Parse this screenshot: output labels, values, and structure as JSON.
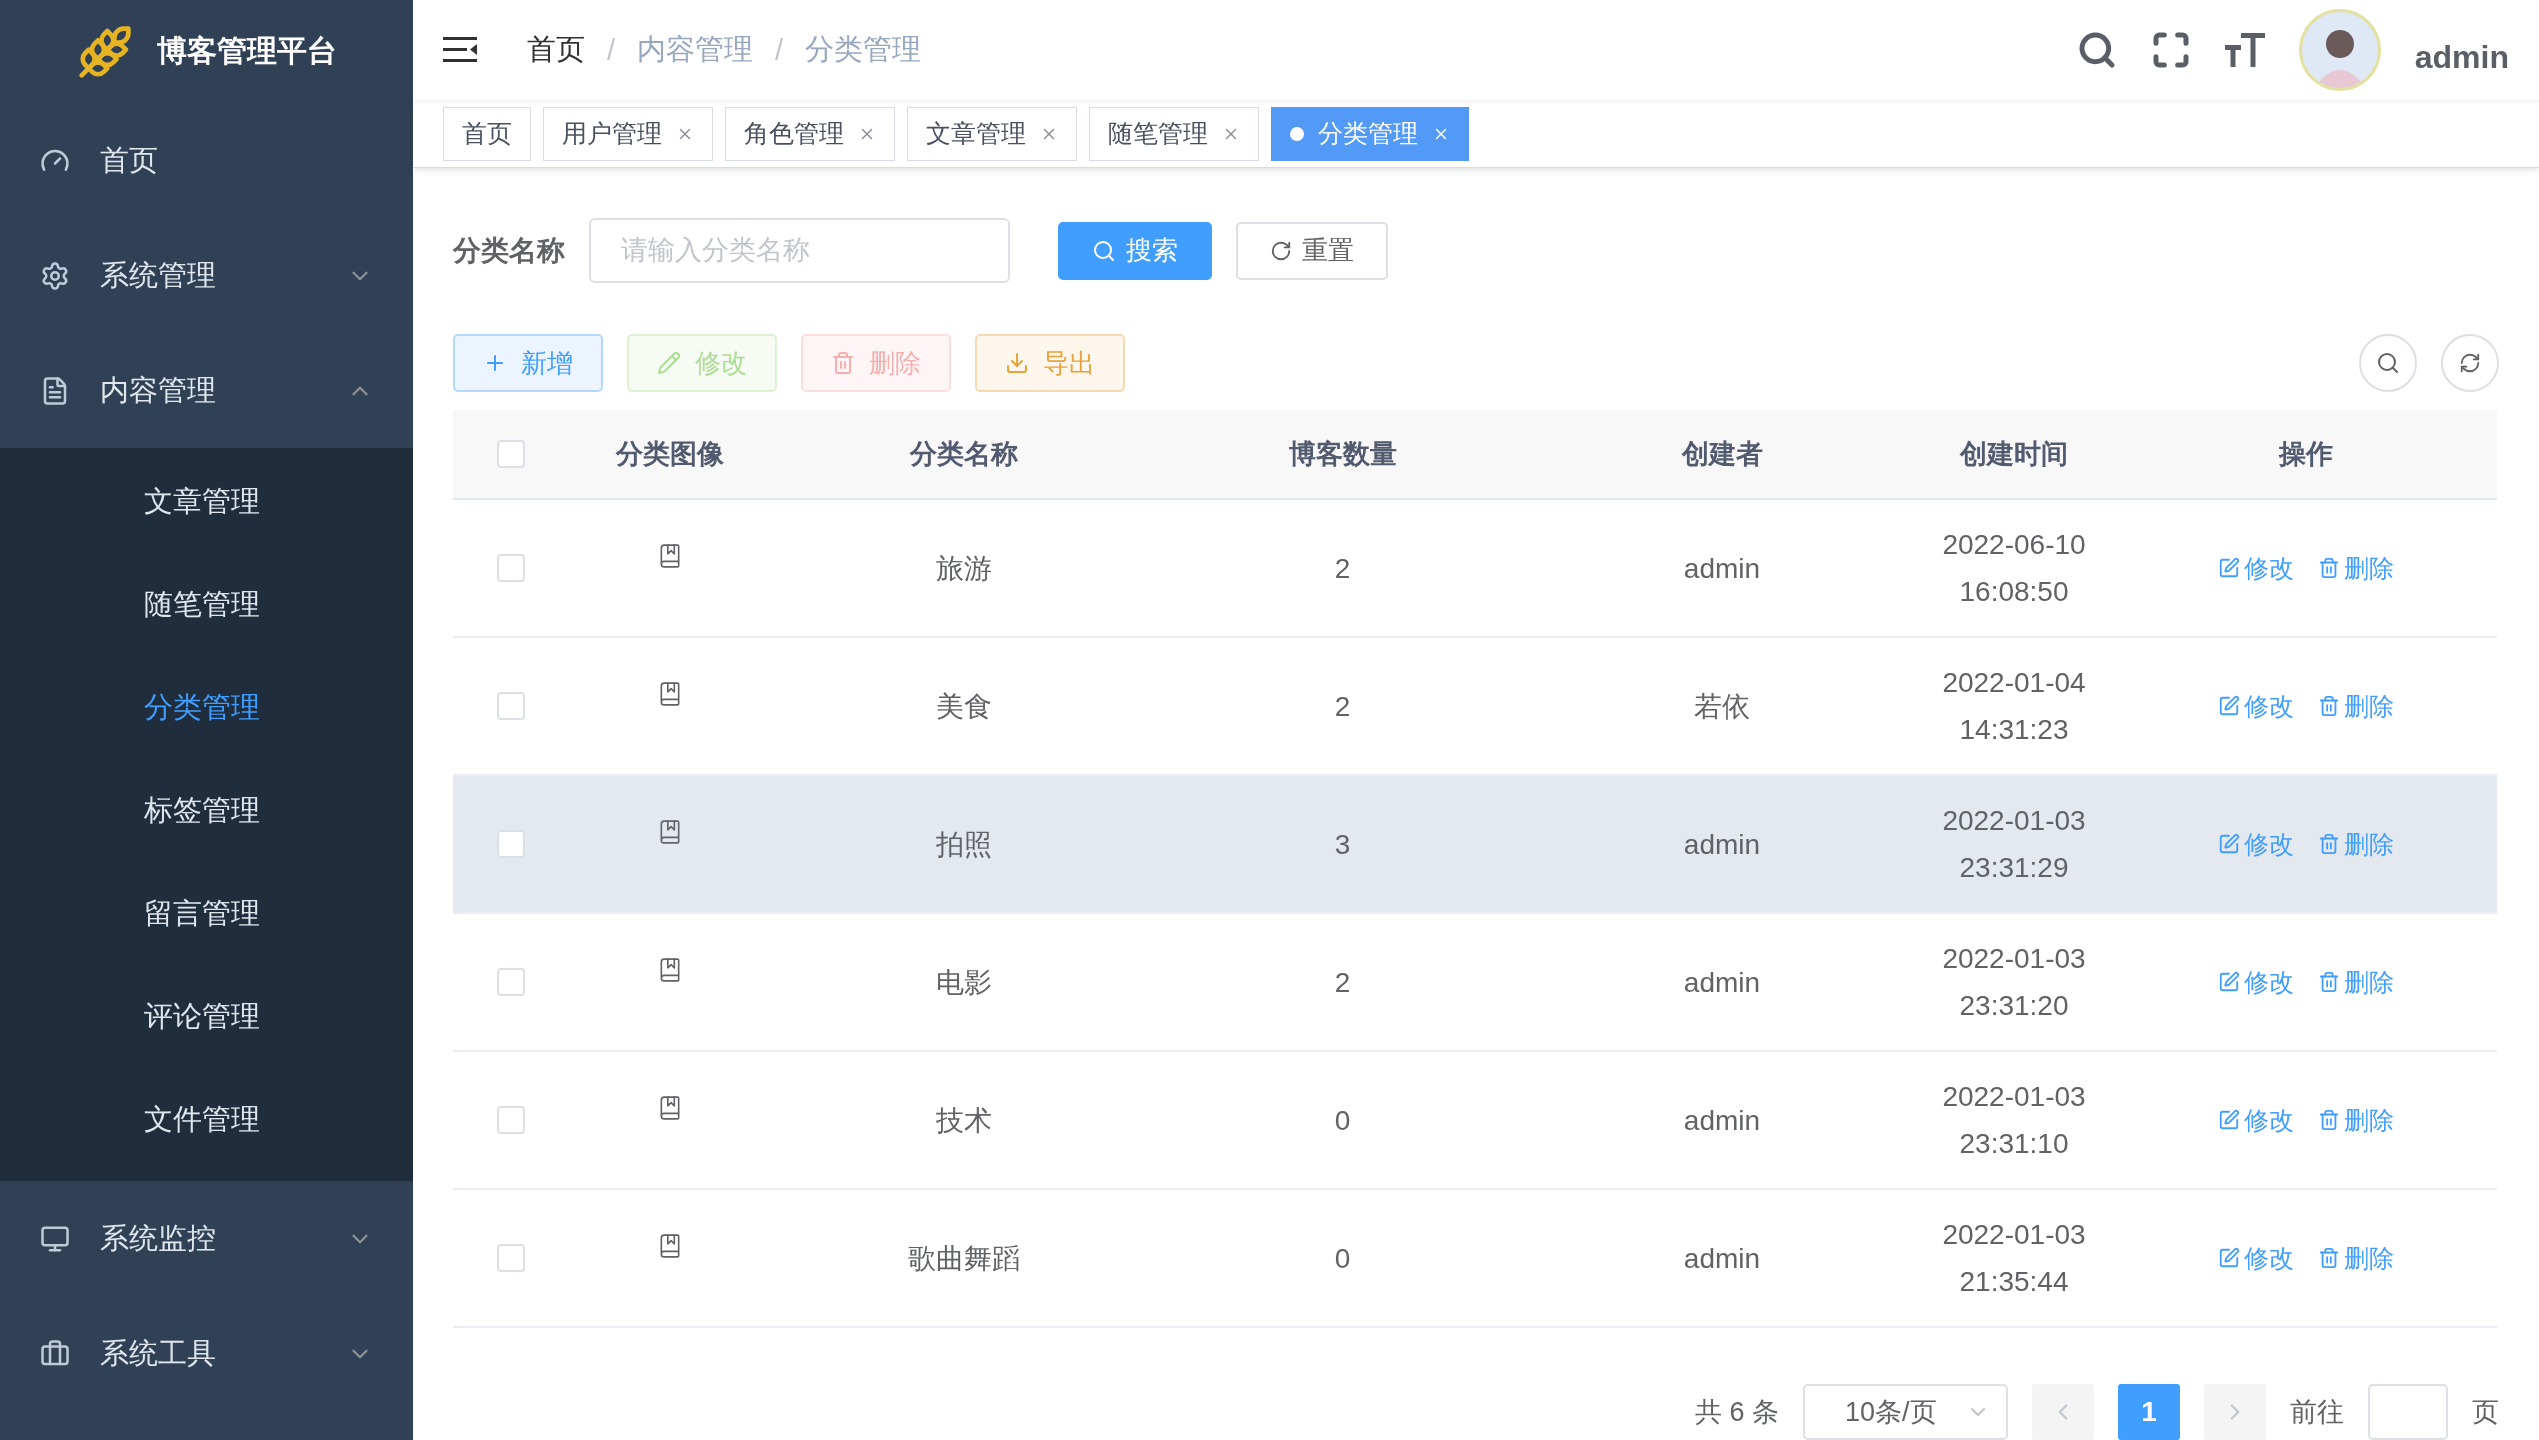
{
  "sidebar": {
    "title": "博客管理平台",
    "menu": [
      {
        "kind": "link",
        "label": "首页"
      },
      {
        "kind": "group",
        "label": "系统管理",
        "expanded": false
      },
      {
        "kind": "group",
        "label": "内容管理",
        "expanded": true,
        "children": [
          {
            "label": "文章管理",
            "selected": false
          },
          {
            "label": "随笔管理",
            "selected": false
          },
          {
            "label": "分类管理",
            "selected": true
          },
          {
            "label": "标签管理",
            "selected": false
          },
          {
            "label": "留言管理",
            "selected": false
          },
          {
            "label": "评论管理",
            "selected": false
          },
          {
            "label": "文件管理",
            "selected": false
          }
        ]
      },
      {
        "kind": "group",
        "label": "系统监控",
        "expanded": false
      },
      {
        "kind": "group",
        "label": "系统工具",
        "expanded": false
      }
    ]
  },
  "header": {
    "breadcrumb": [
      {
        "kind": "link",
        "label": "首页"
      },
      {
        "kind": "separator",
        "label": "/"
      },
      {
        "kind": "current",
        "label": "内容管理"
      },
      {
        "kind": "separator",
        "label": "/"
      },
      {
        "kind": "current",
        "label": "分类管理"
      }
    ],
    "user": {
      "name": "admin"
    }
  },
  "tabs": [
    {
      "label": "首页",
      "selected": false,
      "closable": false
    },
    {
      "label": "用户管理",
      "selected": false,
      "closable": true
    },
    {
      "label": "角色管理",
      "selected": false,
      "closable": true
    },
    {
      "label": "文章管理",
      "selected": false,
      "closable": true
    },
    {
      "label": "随笔管理",
      "selected": false,
      "closable": true
    },
    {
      "label": "分类管理",
      "selected": true,
      "closable": true
    }
  ],
  "search_form": {
    "label": "分类名称",
    "placeholder": "请输入分类名称",
    "buttons": [
      {
        "kind": "primary",
        "label": "搜索"
      },
      {
        "kind": "default",
        "label": "重置"
      }
    ]
  },
  "toolbar": {
    "buttons": [
      {
        "kind": "primary",
        "label": "新增",
        "disabled": false
      },
      {
        "kind": "success",
        "label": "修改",
        "disabled": true
      },
      {
        "kind": "danger",
        "label": "删除",
        "disabled": true
      },
      {
        "kind": "warning",
        "label": "导出",
        "disabled": false
      }
    ]
  },
  "table": {
    "header_checked": false,
    "columns": [
      "分类图像",
      "分类名称",
      "博客数量",
      "创建者",
      "创建时间",
      "操作"
    ],
    "rows": [
      {
        "checked": false,
        "highlighted": false,
        "name": "旅游",
        "count": "2",
        "creator": "admin",
        "created": "2022-06-10 16:08:50",
        "actions": [
          "修改",
          "删除"
        ]
      },
      {
        "checked": false,
        "highlighted": false,
        "name": "美食",
        "count": "2",
        "creator": "若依",
        "created": "2022-01-04 14:31:23",
        "actions": [
          "修改",
          "删除"
        ]
      },
      {
        "checked": false,
        "highlighted": true,
        "name": "拍照",
        "count": "3",
        "creator": "admin",
        "created": "2022-01-03 23:31:29",
        "actions": [
          "修改",
          "删除"
        ]
      },
      {
        "checked": false,
        "highlighted": false,
        "name": "电影",
        "count": "2",
        "creator": "admin",
        "created": "2022-01-03 23:31:20",
        "actions": [
          "修改",
          "删除"
        ]
      },
      {
        "checked": false,
        "highlighted": false,
        "name": "技术",
        "count": "0",
        "creator": "admin",
        "created": "2022-01-03 23:31:10",
        "actions": [
          "修改",
          "删除"
        ]
      },
      {
        "checked": false,
        "highlighted": false,
        "name": "歌曲舞蹈",
        "count": "0",
        "creator": "admin",
        "created": "2022-01-03 21:35:44",
        "actions": [
          "修改",
          "删除"
        ]
      }
    ]
  },
  "pagination": {
    "total": "共 6 条",
    "page_size": "10条/页",
    "prev_disabled": true,
    "pages": [
      {
        "label": "1",
        "selected": true
      }
    ],
    "next_disabled": true,
    "goto_label": "前往",
    "goto_suffix": "页"
  }
}
